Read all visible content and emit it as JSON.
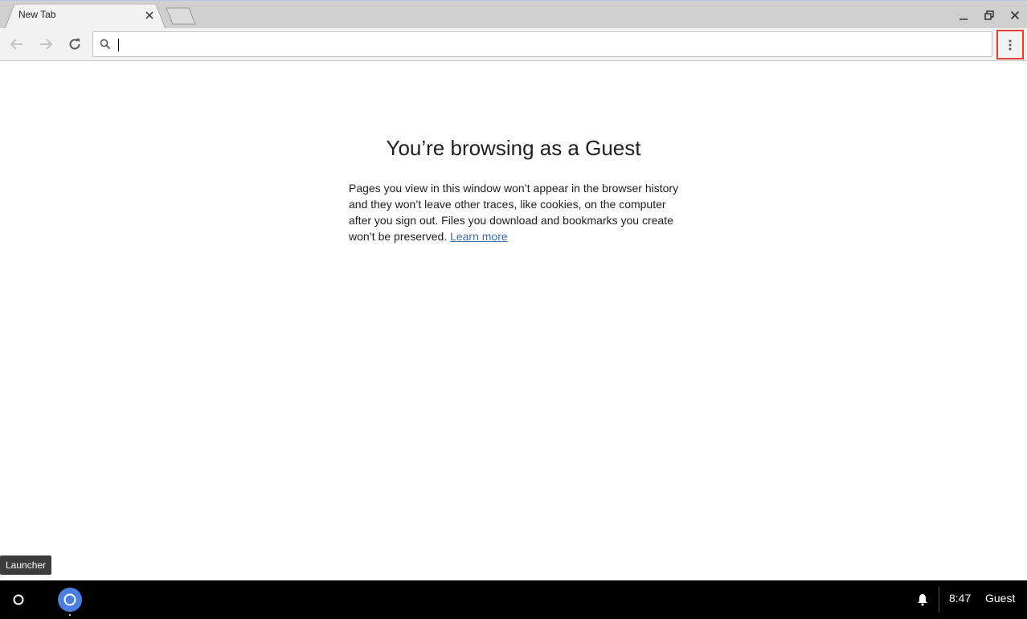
{
  "browser": {
    "active_tab_title": "New Tab",
    "omnibox": {
      "value": "",
      "placeholder": ""
    }
  },
  "page": {
    "title": "You’re browsing as a Guest",
    "description": "Pages you view in this window won’t appear in the browser history and they won’t leave other traces, like cookies, on the computer after you sign out. Files you download and bookmarks you create won’t be preserved.",
    "learn_more_label": "Learn more"
  },
  "tooltip": {
    "text": "Launcher"
  },
  "shelf": {
    "time": "8:47",
    "user": "Guest"
  },
  "colors": {
    "menu_highlight": "#e8402e",
    "link": "#3b6fb4",
    "shelf_background": "#000000",
    "chrome_icon": "#4a7fe0"
  },
  "icons": {
    "back": "arrow-back-icon",
    "forward": "arrow-forward-icon",
    "reload": "reload-icon",
    "search": "search-icon",
    "menu": "vertical-dots-icon",
    "close_tab": "close-icon",
    "minimize": "minimize-icon",
    "restore": "restore-icon",
    "close_window": "close-icon",
    "launcher": "launcher-circle-icon",
    "app": "chrome-icon",
    "notifications": "bell-icon"
  }
}
